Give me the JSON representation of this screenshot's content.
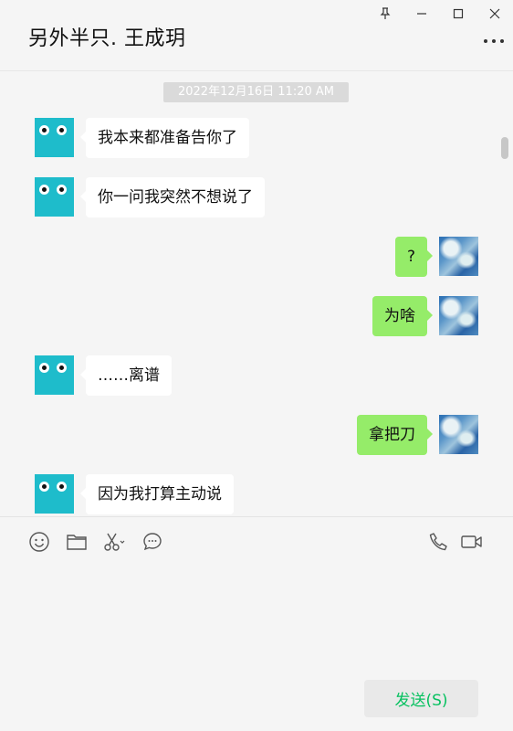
{
  "window": {
    "controls": [
      "pin-icon",
      "minimize-icon",
      "maximize-icon",
      "close-icon"
    ]
  },
  "header": {
    "title": "另外半只. 王成玥",
    "more_icon": "more-dots-icon"
  },
  "chat": {
    "timestamp": "2022年12月16日 11:20 AM",
    "messages": [
      {
        "side": "in",
        "text": "我本来都准备告你了"
      },
      {
        "side": "in",
        "text": "你一问我突然不想说了"
      },
      {
        "side": "out",
        "text": "?"
      },
      {
        "side": "out",
        "text": "为啥"
      },
      {
        "side": "in",
        "text": "……离谱"
      },
      {
        "side": "out",
        "text": "拿把刀"
      },
      {
        "side": "in",
        "text": "因为我打算主动说"
      }
    ]
  },
  "toolbar": {
    "left_icons": [
      "emoji-icon",
      "folder-icon",
      "scissors-icon",
      "chat-bubble-icon"
    ],
    "right_icons": [
      "phone-icon",
      "video-icon"
    ]
  },
  "input": {
    "value": ""
  },
  "send_button": {
    "label": "发送(S)"
  },
  "colors": {
    "background": "#f5f5f5",
    "incoming_bubble": "#ffffff",
    "outgoing_bubble": "#95ec69",
    "avatar_teal": "#1ebccb",
    "send_text": "#07c160"
  }
}
